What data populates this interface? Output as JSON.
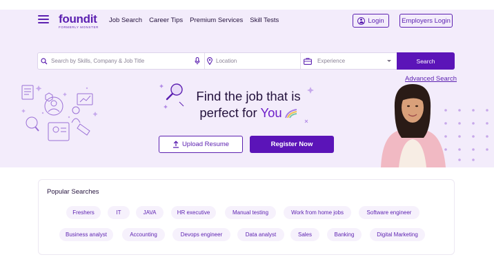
{
  "header": {
    "logo_text": "foundit",
    "logo_sub": "FORMERLY MONSTER",
    "nav": [
      "Job Search",
      "Career Tips",
      "Premium Services",
      "Skill Tests"
    ],
    "login_label": "Login",
    "employers_label": "Employers Login"
  },
  "search": {
    "keyword_placeholder": "Search by Skills, Company & Job Title",
    "location_placeholder": "Location",
    "experience_placeholder": "Experience",
    "button_label": "Search",
    "advanced_label": "Advanced Search"
  },
  "hero": {
    "headline_line1": "Find the job that is",
    "headline_line2_prefix": "perfect for",
    "headline_highlight": "You",
    "upload_label": "Upload Resume",
    "register_label": "Register Now"
  },
  "popular": {
    "title": "Popular Searches",
    "row1": [
      "Freshers",
      "IT",
      "JAVA",
      "HR executive",
      "Manual testing",
      "Work from home jobs",
      "Software engineer"
    ],
    "row2": [
      "Business analyst",
      "Accounting",
      "Devops engineer",
      "Data analyst",
      "Sales",
      "Banking",
      "Digital Marketing"
    ]
  },
  "colors": {
    "brand_purple": "#5b14b8",
    "hero_bg": "#f3ecfb",
    "logo_accent": "#f07f3c"
  },
  "icons": [
    "menu-icon",
    "user-icon",
    "search-icon",
    "mic-icon",
    "location-pin-icon",
    "briefcase-icon",
    "chevron-down-icon",
    "upload-icon"
  ]
}
